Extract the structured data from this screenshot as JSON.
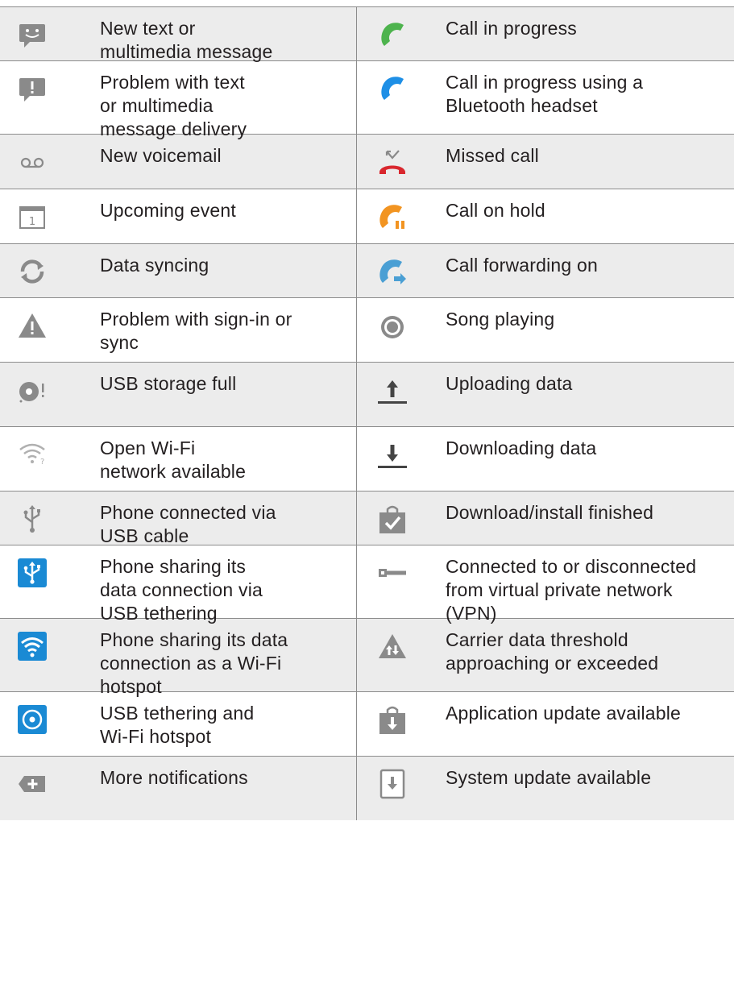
{
  "rows": [
    {
      "left": {
        "icon": "message-icon",
        "label": "New text or\nmultimedia message"
      },
      "right": {
        "icon": "call-green-icon",
        "label": "Call in progress"
      }
    },
    {
      "left": {
        "icon": "message-alert-icon",
        "label": "Problem with text\nor multimedia\nmessage delivery"
      },
      "right": {
        "icon": "call-bluetooth-icon",
        "label": "Call in progress using a\nBluetooth headset"
      }
    },
    {
      "left": {
        "icon": "voicemail-icon",
        "label": "New voicemail"
      },
      "right": {
        "icon": "missed-call-icon",
        "label": "Missed call"
      }
    },
    {
      "left": {
        "icon": "calendar-icon",
        "label": "Upcoming event"
      },
      "right": {
        "icon": "call-hold-icon",
        "label": "Call on hold"
      }
    },
    {
      "left": {
        "icon": "sync-icon",
        "label": "Data syncing"
      },
      "right": {
        "icon": "call-forward-icon",
        "label": "Call forwarding on"
      }
    },
    {
      "left": {
        "icon": "warning-icon",
        "label": "Problem with sign-in or\nsync"
      },
      "right": {
        "icon": "song-playing-icon",
        "label": "Song playing"
      }
    },
    {
      "left": {
        "icon": "usb-storage-full-icon",
        "label": "USB storage full"
      },
      "right": {
        "icon": "upload-icon",
        "label": "Uploading data"
      }
    },
    {
      "left": {
        "icon": "wifi-open-icon",
        "label": "Open Wi-Fi\nnetwork available"
      },
      "right": {
        "icon": "download-icon",
        "label": "Downloading data"
      }
    },
    {
      "left": {
        "icon": "usb-icon",
        "label": "Phone connected via\nUSB cable"
      },
      "right": {
        "icon": "download-finished-icon",
        "label": "Download/install finished"
      }
    },
    {
      "left": {
        "icon": "usb-tether-icon",
        "label": "Phone sharing its\ndata connection via\nUSB tethering"
      },
      "right": {
        "icon": "vpn-key-icon",
        "label": "Connected to or disconnected\nfrom virtual private network\n(VPN)"
      }
    },
    {
      "left": {
        "icon": "wifi-hotspot-icon",
        "label": "Phone sharing its data\nconnection as a Wi-Fi\nhotspot"
      },
      "right": {
        "icon": "data-threshold-icon",
        "label": "Carrier data threshold\napproaching or exceeded"
      }
    },
    {
      "left": {
        "icon": "tether-hotspot-icon",
        "label": "USB tethering and\nWi-Fi hotspot"
      },
      "right": {
        "icon": "app-update-icon",
        "label": "Application update available"
      }
    },
    {
      "left": {
        "icon": "more-notifications-icon",
        "label": "More notifications"
      },
      "right": {
        "icon": "system-update-icon",
        "label": "System update available"
      }
    }
  ],
  "colors": {
    "shade": "#ececec",
    "rule": "#8c8c8c",
    "text": "#231f20",
    "icon_gray": "#8a8a8a",
    "call_green": "#4db34d",
    "call_blue": "#1e8fe6",
    "missed_red": "#d9272e",
    "hold_orange": "#f29421",
    "tether_blue": "#1a8ad4"
  }
}
